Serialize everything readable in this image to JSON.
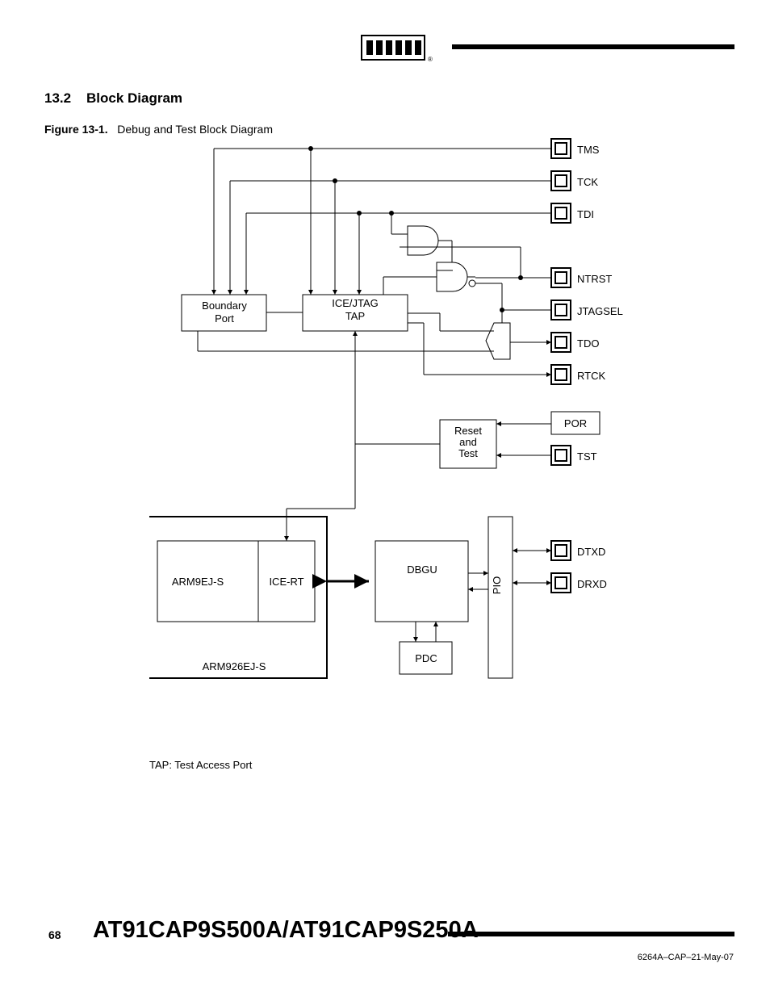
{
  "header": {
    "logo_text": "ATMEL"
  },
  "section": {
    "number": "13.2",
    "title": "Block Diagram"
  },
  "figure": {
    "label": "Figure 13-1.",
    "caption": "Debug and Test Block Diagram"
  },
  "diagram": {
    "pins": {
      "tms": "TMS",
      "tck": "TCK",
      "tdi": "TDI",
      "ntrst": "NTRST",
      "jtagsel": "JTAGSEL",
      "tdo": "TDO",
      "rtck": "RTCK",
      "tst": "TST",
      "dtxd": "DTXD",
      "drxd": "DRXD"
    },
    "blocks": {
      "boundary_port": "Boundary\nPort",
      "boundary_port_l1": "Boundary",
      "boundary_port_l2": "Port",
      "ice_jtag_tap": "ICE/JTAG\nTAP",
      "ice_jtag_tap_l1": "ICE/JTAG",
      "ice_jtag_tap_l2": "TAP",
      "reset_test_l1": "Reset",
      "reset_test_l2": "and",
      "reset_test_l3": "Test",
      "por": "POR",
      "arm9ejs": "ARM9EJ-S",
      "ice_rt": "ICE-RT",
      "arm926ejs": "ARM926EJ-S",
      "dbgu": "DBGU",
      "pdc": "PDC",
      "pio": "PIO"
    },
    "note": "TAP: Test  Access Port"
  },
  "footer": {
    "page": "68",
    "title": "AT91CAP9S500A/AT91CAP9S250A",
    "docnum": "6264A–CAP–21-May-07"
  }
}
